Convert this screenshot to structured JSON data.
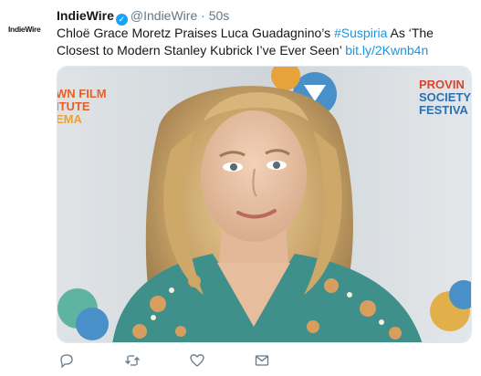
{
  "account": {
    "avatar_text": "IndieWire",
    "display_name": "IndieWire",
    "handle": "@IndieWire",
    "separator": "·",
    "time": "50s",
    "verified": true
  },
  "tweet": {
    "text_before": "Chloë Grace Moretz Praises Luca Guadagnino’s ",
    "hashtag": "#Suspiria",
    "text_after": " As ‘The Closest to Modern Stanley Kubrick I’ve Ever Seen’ ",
    "link": "bit.ly/2Kwnb4n"
  },
  "media": {
    "backdrop_left_text": [
      "WN FILM",
      "ITUTE",
      "EMA"
    ],
    "backdrop_right_text": [
      "PROVIN",
      "SOCIETY",
      "FESTIVA"
    ]
  },
  "actions": [
    {
      "icon": "reply-icon"
    },
    {
      "icon": "retweet-icon"
    },
    {
      "icon": "like-icon"
    },
    {
      "icon": "direct-message-icon"
    }
  ],
  "colors": {
    "link": "#1b95e0",
    "verified": "#1da1f2",
    "muted": "#657786",
    "icon": "#657786"
  }
}
